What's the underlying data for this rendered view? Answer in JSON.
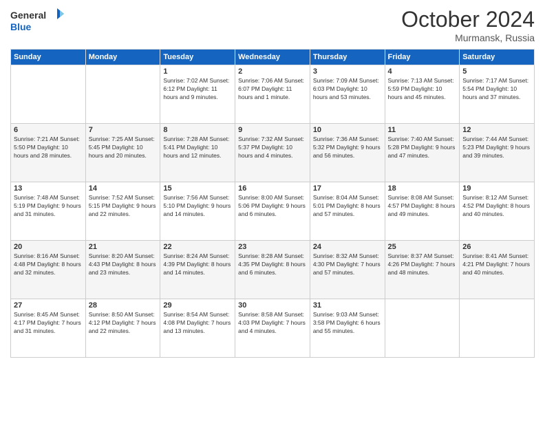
{
  "header": {
    "logo_general": "General",
    "logo_blue": "Blue",
    "month_title": "October 2024",
    "location": "Murmansk, Russia"
  },
  "weekdays": [
    "Sunday",
    "Monday",
    "Tuesday",
    "Wednesday",
    "Thursday",
    "Friday",
    "Saturday"
  ],
  "weeks": [
    [
      {
        "day": "",
        "info": ""
      },
      {
        "day": "",
        "info": ""
      },
      {
        "day": "1",
        "info": "Sunrise: 7:02 AM\nSunset: 6:12 PM\nDaylight: 11 hours\nand 9 minutes."
      },
      {
        "day": "2",
        "info": "Sunrise: 7:06 AM\nSunset: 6:07 PM\nDaylight: 11 hours\nand 1 minute."
      },
      {
        "day": "3",
        "info": "Sunrise: 7:09 AM\nSunset: 6:03 PM\nDaylight: 10 hours\nand 53 minutes."
      },
      {
        "day": "4",
        "info": "Sunrise: 7:13 AM\nSunset: 5:59 PM\nDaylight: 10 hours\nand 45 minutes."
      },
      {
        "day": "5",
        "info": "Sunrise: 7:17 AM\nSunset: 5:54 PM\nDaylight: 10 hours\nand 37 minutes."
      }
    ],
    [
      {
        "day": "6",
        "info": "Sunrise: 7:21 AM\nSunset: 5:50 PM\nDaylight: 10 hours\nand 28 minutes."
      },
      {
        "day": "7",
        "info": "Sunrise: 7:25 AM\nSunset: 5:45 PM\nDaylight: 10 hours\nand 20 minutes."
      },
      {
        "day": "8",
        "info": "Sunrise: 7:28 AM\nSunset: 5:41 PM\nDaylight: 10 hours\nand 12 minutes."
      },
      {
        "day": "9",
        "info": "Sunrise: 7:32 AM\nSunset: 5:37 PM\nDaylight: 10 hours\nand 4 minutes."
      },
      {
        "day": "10",
        "info": "Sunrise: 7:36 AM\nSunset: 5:32 PM\nDaylight: 9 hours\nand 56 minutes."
      },
      {
        "day": "11",
        "info": "Sunrise: 7:40 AM\nSunset: 5:28 PM\nDaylight: 9 hours\nand 47 minutes."
      },
      {
        "day": "12",
        "info": "Sunrise: 7:44 AM\nSunset: 5:23 PM\nDaylight: 9 hours\nand 39 minutes."
      }
    ],
    [
      {
        "day": "13",
        "info": "Sunrise: 7:48 AM\nSunset: 5:19 PM\nDaylight: 9 hours\nand 31 minutes."
      },
      {
        "day": "14",
        "info": "Sunrise: 7:52 AM\nSunset: 5:15 PM\nDaylight: 9 hours\nand 22 minutes."
      },
      {
        "day": "15",
        "info": "Sunrise: 7:56 AM\nSunset: 5:10 PM\nDaylight: 9 hours\nand 14 minutes."
      },
      {
        "day": "16",
        "info": "Sunrise: 8:00 AM\nSunset: 5:06 PM\nDaylight: 9 hours\nand 6 minutes."
      },
      {
        "day": "17",
        "info": "Sunrise: 8:04 AM\nSunset: 5:01 PM\nDaylight: 8 hours\nand 57 minutes."
      },
      {
        "day": "18",
        "info": "Sunrise: 8:08 AM\nSunset: 4:57 PM\nDaylight: 8 hours\nand 49 minutes."
      },
      {
        "day": "19",
        "info": "Sunrise: 8:12 AM\nSunset: 4:52 PM\nDaylight: 8 hours\nand 40 minutes."
      }
    ],
    [
      {
        "day": "20",
        "info": "Sunrise: 8:16 AM\nSunset: 4:48 PM\nDaylight: 8 hours\nand 32 minutes."
      },
      {
        "day": "21",
        "info": "Sunrise: 8:20 AM\nSunset: 4:43 PM\nDaylight: 8 hours\nand 23 minutes."
      },
      {
        "day": "22",
        "info": "Sunrise: 8:24 AM\nSunset: 4:39 PM\nDaylight: 8 hours\nand 14 minutes."
      },
      {
        "day": "23",
        "info": "Sunrise: 8:28 AM\nSunset: 4:35 PM\nDaylight: 8 hours\nand 6 minutes."
      },
      {
        "day": "24",
        "info": "Sunrise: 8:32 AM\nSunset: 4:30 PM\nDaylight: 7 hours\nand 57 minutes."
      },
      {
        "day": "25",
        "info": "Sunrise: 8:37 AM\nSunset: 4:26 PM\nDaylight: 7 hours\nand 48 minutes."
      },
      {
        "day": "26",
        "info": "Sunrise: 8:41 AM\nSunset: 4:21 PM\nDaylight: 7 hours\nand 40 minutes."
      }
    ],
    [
      {
        "day": "27",
        "info": "Sunrise: 8:45 AM\nSunset: 4:17 PM\nDaylight: 7 hours\nand 31 minutes."
      },
      {
        "day": "28",
        "info": "Sunrise: 8:50 AM\nSunset: 4:12 PM\nDaylight: 7 hours\nand 22 minutes."
      },
      {
        "day": "29",
        "info": "Sunrise: 8:54 AM\nSunset: 4:08 PM\nDaylight: 7 hours\nand 13 minutes."
      },
      {
        "day": "30",
        "info": "Sunrise: 8:58 AM\nSunset: 4:03 PM\nDaylight: 7 hours\nand 4 minutes."
      },
      {
        "day": "31",
        "info": "Sunrise: 9:03 AM\nSunset: 3:58 PM\nDaylight: 6 hours\nand 55 minutes."
      },
      {
        "day": "",
        "info": ""
      },
      {
        "day": "",
        "info": ""
      }
    ]
  ]
}
